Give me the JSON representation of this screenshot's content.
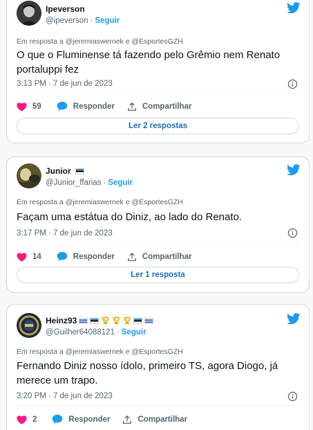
{
  "colors": {
    "accent": "#1d9bf0",
    "like": "#f91880",
    "muted": "#536471"
  },
  "tweets": [
    {
      "name": "Ipeverson",
      "handle": "@ipeverson",
      "dot": "·",
      "follow": "Seguir",
      "reply_prefix": "Em resposta a",
      "reply_user1": "@jeremiaswernek",
      "reply_and": "e",
      "reply_user2": "@EsportesGZH",
      "text": "O que o Fluminense tá fazendo pelo Grêmio nem Renato portaluppi fez",
      "time": "3:13 PM · 7 de jun de 2023",
      "likes": "59",
      "reply_label": "Responder",
      "share_label": "Compartilhar",
      "more_label": "Ler 2 respostas"
    },
    {
      "name": "Junior",
      "handle": "@Junior_ffarias",
      "dot": "·",
      "follow": "Seguir",
      "reply_prefix": "Em resposta a",
      "reply_user1": "@jeremiaswernek",
      "reply_and": "e",
      "reply_user2": "@EsportesGZH",
      "text": "Façam uma estátua do Diniz, ao lado do Renato.",
      "time": "3:17 PM · 7 de jun de 2023",
      "likes": "14",
      "reply_label": "Responder",
      "share_label": "Compartilhar",
      "more_label": "Ler 1 resposta"
    },
    {
      "name": "Heinz93",
      "handle": "@Guilher64088121",
      "dot": "·",
      "follow": "Seguir",
      "reply_prefix": "Em resposta a",
      "reply_user1": "@jeremiaswernek",
      "reply_and": "e",
      "reply_user2": "@EsportesGZH",
      "text": "Fernando Diniz nosso ídolo, primeiro TS, agora Diogo, já merece um trapo.",
      "time": "3:20 PM · 7 de jun de 2023",
      "likes": "2",
      "reply_label": "Responder",
      "share_label": "Compartilhar"
    }
  ]
}
